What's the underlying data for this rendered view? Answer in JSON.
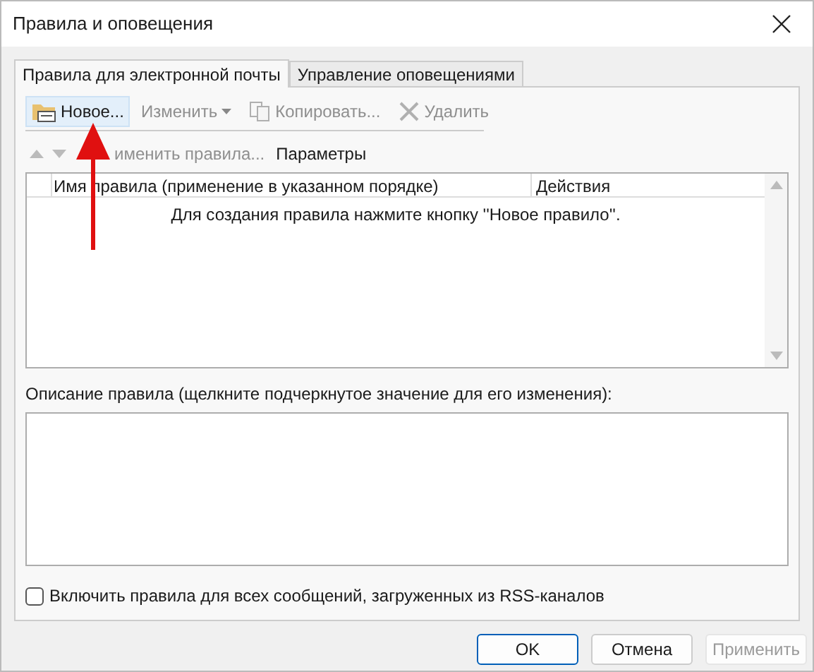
{
  "window": {
    "title": "Правила и оповещения"
  },
  "tabs": [
    {
      "label": "Правила для электронной почты",
      "selected": true
    },
    {
      "label": "Управление оповещениями",
      "selected": false
    }
  ],
  "toolbar": [
    {
      "label": "Новое...",
      "kind": "new",
      "disabled": false,
      "dropdown": false
    },
    {
      "label": "Изменить",
      "kind": "edit",
      "disabled": true,
      "dropdown": true
    },
    {
      "label": "Копировать...",
      "kind": "copy",
      "disabled": true,
      "dropdown": false
    },
    {
      "label": "Удалить",
      "kind": "delete",
      "disabled": true,
      "dropdown": false
    }
  ],
  "toolbar2": {
    "apply": "именить правила...",
    "options": "Параметры"
  },
  "table": {
    "columns": [
      "Имя правила (применение в указанном порядке)",
      "Действия"
    ],
    "empty_message": "Для создания правила нажмите кнопку ''Новое правило''."
  },
  "description": {
    "label": "Описание правила (щелкните подчеркнутое значение для его изменения):"
  },
  "rss": {
    "label": "Включить правила для всех сообщений, загруженных из RSS-каналов",
    "checked": false
  },
  "buttons": [
    {
      "label": "OK",
      "kind": "default",
      "disabled": false
    },
    {
      "label": "Отмена",
      "kind": "normal",
      "disabled": false
    },
    {
      "label": "Применить",
      "kind": "normal",
      "disabled": true
    }
  ]
}
